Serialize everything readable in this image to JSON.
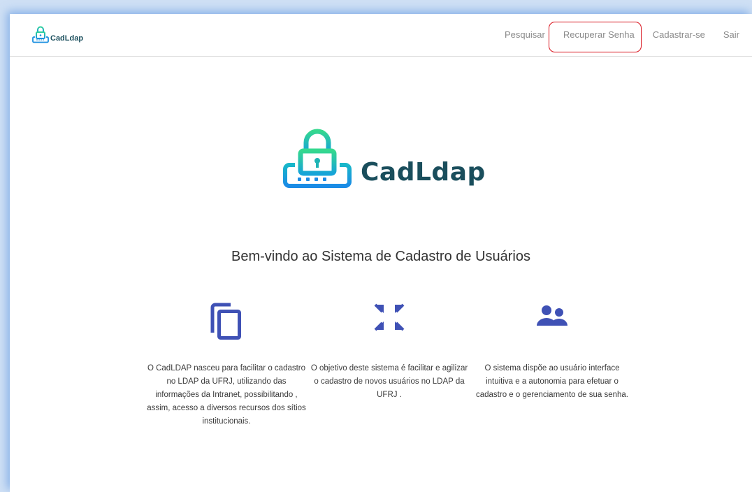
{
  "brand": {
    "name": "CadLdap",
    "icon": "lock-keyboard-icon"
  },
  "nav": {
    "items": [
      {
        "label": "Pesquisar"
      },
      {
        "label": "Recuperar Senha",
        "highlighted": true
      },
      {
        "label": "Cadastrar-se"
      },
      {
        "label": "Sair"
      }
    ]
  },
  "hero": {
    "logo_text": "CadLdap"
  },
  "welcome": "Bem-vindo ao Sistema de Cadastro de Usuários",
  "features": [
    {
      "icon": "copy-icon",
      "text": "O CadLDAP nasceu para facilitar o cadastro no LDAP da UFRJ, utilizando das informações da Intranet, possibilitando , assim, acesso a diversos recursos dos sítios institucionais."
    },
    {
      "icon": "compress-arrows-icon",
      "text": "O objetivo deste sistema é facilitar e agilizar o cadastro de novos usuários no LDAP da UFRJ ."
    },
    {
      "icon": "users-icon",
      "text": "O sistema dispõe ao usuário interface intuitiva e a autonomia para efetuar o cadastro e o gerenciamento de sua senha."
    }
  ],
  "colors": {
    "accent": "#3f51b5",
    "brand_dark": "#1a4e5c",
    "highlight": "#d8101a"
  }
}
